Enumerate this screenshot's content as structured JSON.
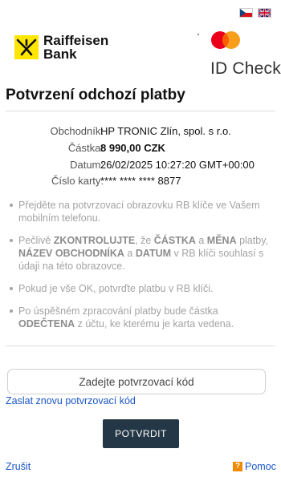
{
  "header": {
    "bank_name_line1": "Raiffeisen",
    "bank_name_line2": "Bank",
    "id_check_label": "ID Check",
    "colors": {
      "raiffeisen_yellow": "#fee600",
      "mastercard_red": "#eb001b",
      "mastercard_orange": "#f79e1b",
      "mastercard_overlap": "#ff5f00"
    },
    "languages": [
      {
        "code": "cs",
        "icon": "czech-flag-icon"
      },
      {
        "code": "en",
        "icon": "uk-flag-icon"
      }
    ]
  },
  "page_title": "Potvrzení odchozí platby",
  "details": [
    {
      "label": "Obchodník:",
      "value": "HP TRONIC Zlín, spol. s r.o.",
      "bold": false
    },
    {
      "label": "Částka:",
      "value": "8 990,00 CZK",
      "bold": true
    },
    {
      "label": "Datum:",
      "value": "26/02/2025 10:27:20 GMT+00:00",
      "bold": false
    },
    {
      "label": "Číslo karty:",
      "value": "**** **** **** 8877",
      "bold": false
    }
  ],
  "instructions": {
    "item1": "Přejděte na potvrzovací obrazovku RB klíče ve Vašem mobilním telefonu.",
    "item2": {
      "t1": "Pečlivě ",
      "b1": "ZKONTROLUJTE",
      "t2": ", že ",
      "b2": "ČÁSTKA",
      "t3": " a ",
      "b3": "MĚNA",
      "t4": " platby, ",
      "b4": "NÁZEV OBCHODNÍKA",
      "t5": " a ",
      "b5": "DATUM",
      "t6": " v RB klíči souhlasí s údaji na této obrazovce."
    },
    "item3": "Pokud je vše OK, potvrďte platbu v RB klíči.",
    "item4": {
      "t1": "Po úspěšném zpracování platby bude částka ",
      "b1": "ODEČTENA",
      "t2": " z účtu, ke kterému je karta vedena."
    }
  },
  "form": {
    "code_placeholder": "Zadejte potvrzovací kód",
    "code_value": "",
    "resend_link": "Zaslat znovu potvrzovací kód",
    "confirm_button": "POTVRDIT"
  },
  "footer": {
    "cancel_link": "Zrušit",
    "help_link": "Pomoc",
    "help_icon_glyph": "?"
  },
  "colors": {
    "button_bg": "#243746",
    "link": "#1a56c8",
    "help_orange": "#f08a00"
  }
}
